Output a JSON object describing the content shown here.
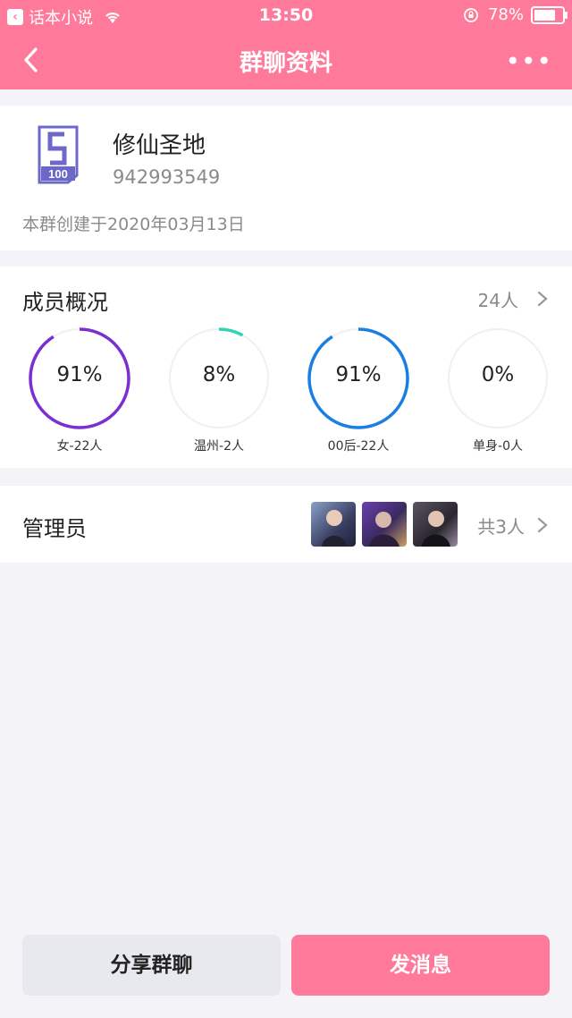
{
  "status_bar": {
    "carrier": "话本小说",
    "time": "13:50",
    "battery": "78%",
    "battery_level": 0.78
  },
  "nav": {
    "title": "群聊资料",
    "more": "•••"
  },
  "group": {
    "name": "修仙圣地",
    "id": "942993549",
    "created": "本群创建于2020年03月13日"
  },
  "members": {
    "title": "成员概况",
    "count": "24人",
    "stats": [
      {
        "percent": "91%",
        "value": 0.91,
        "label": "女-22人",
        "color": "#7b2fd0"
      },
      {
        "percent": "8%",
        "value": 0.08,
        "label": "温州-2人",
        "color": "#2ed5b4"
      },
      {
        "percent": "91%",
        "value": 0.91,
        "label": "00后-22人",
        "color": "#1a7fe0"
      },
      {
        "percent": "0%",
        "value": 0.0,
        "label": "单身-0人",
        "color": "#cccccc"
      }
    ]
  },
  "admins": {
    "title": "管理员",
    "count": "共3人"
  },
  "buttons": {
    "share": "分享群聊",
    "send": "发消息"
  }
}
